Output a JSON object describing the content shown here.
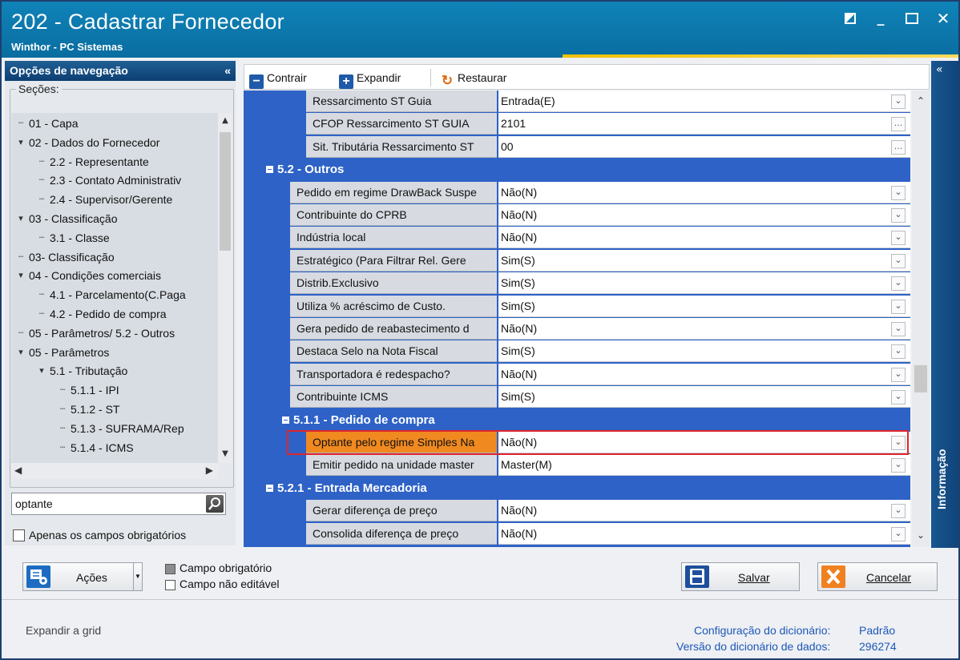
{
  "window": {
    "title": "202 - Cadastrar  Fornecedor",
    "subtitle": "Winthor - PC Sistemas"
  },
  "nav": {
    "header": "Opções de navegação",
    "collapse": "«",
    "sections_label": "Seções:",
    "tree": [
      {
        "label": "01 - Capa",
        "level": 0,
        "expander": ""
      },
      {
        "label": "02 - Dados do Fornecedor",
        "level": 0,
        "expander": "v"
      },
      {
        "label": "2.2 - Representante",
        "level": 1,
        "expander": ""
      },
      {
        "label": "2.3 - Contato Administrativ",
        "level": 1,
        "expander": ""
      },
      {
        "label": "2.4 - Supervisor/Gerente",
        "level": 1,
        "expander": ""
      },
      {
        "label": "03 - Classificação",
        "level": 0,
        "expander": "v"
      },
      {
        "label": "3.1 - Classe",
        "level": 1,
        "expander": ""
      },
      {
        "label": "03- Classificação",
        "level": 0,
        "expander": ""
      },
      {
        "label": "04 - Condições comerciais",
        "level": 0,
        "expander": "v"
      },
      {
        "label": "4.1 - Parcelamento(C.Paga",
        "level": 1,
        "expander": ""
      },
      {
        "label": "4.2 - Pedido de compra",
        "level": 1,
        "expander": ""
      },
      {
        "label": "05 - Parâmetros/ 5.2 - Outros",
        "level": 0,
        "expander": ""
      },
      {
        "label": "05 - Parâmetros",
        "level": 0,
        "expander": "v"
      },
      {
        "label": "5.1 - Tributação",
        "level": 1,
        "expander": "v"
      },
      {
        "label": "5.1.1 - IPI",
        "level": 2,
        "expander": ""
      },
      {
        "label": "5.1.2 - ST",
        "level": 2,
        "expander": ""
      },
      {
        "label": "5.1.3 - SUFRAMA/Rep",
        "level": 2,
        "expander": ""
      },
      {
        "label": "5.1.4 - ICMS",
        "level": 2,
        "expander": ""
      }
    ],
    "search_value": "optante",
    "only_required_label": "Apenas os campos obrigatórios"
  },
  "toolbar": {
    "collapse_label": "Contrair",
    "expand_label": "Expandir",
    "restore_label": "Restaurar"
  },
  "grid": {
    "rows": [
      {
        "type": "field",
        "name": "Ressarcimento ST Guia",
        "value": "Entrada(E)",
        "editor": "dropdown",
        "indent": 2
      },
      {
        "type": "field",
        "name": "CFOP Ressarcimento ST GUIA",
        "value": "2101",
        "editor": "ellipsis",
        "indent": 2
      },
      {
        "type": "field",
        "name": "Sit. Tributária Ressarcimento ST",
        "value": "00",
        "editor": "ellipsis",
        "indent": 2
      },
      {
        "type": "section",
        "name": "5.2 - Outros",
        "indent": 0
      },
      {
        "type": "field",
        "name": "Pedido em regime DrawBack Suspe",
        "value": "Não(N)",
        "editor": "dropdown",
        "indent": 1
      },
      {
        "type": "field",
        "name": "Contribuinte do CPRB",
        "value": "Não(N)",
        "editor": "dropdown",
        "indent": 1
      },
      {
        "type": "field",
        "name": "Indústria local",
        "value": "Não(N)",
        "editor": "dropdown",
        "indent": 1
      },
      {
        "type": "field",
        "name": "Estratégico  (Para Filtrar Rel. Gere",
        "value": "Sim(S)",
        "editor": "dropdown",
        "indent": 1
      },
      {
        "type": "field",
        "name": "Distrib.Exclusivo",
        "value": "Sim(S)",
        "editor": "dropdown",
        "indent": 1
      },
      {
        "type": "field",
        "name": "Utiliza % acréscimo de Custo.",
        "value": "Sim(S)",
        "editor": "dropdown",
        "indent": 1
      },
      {
        "type": "field",
        "name": "Gera pedido de reabastecimento d",
        "value": "Não(N)",
        "editor": "dropdown",
        "indent": 1
      },
      {
        "type": "field",
        "name": "Destaca Selo na Nota Fiscal",
        "value": "Sim(S)",
        "editor": "dropdown",
        "indent": 1
      },
      {
        "type": "field",
        "name": "Transportadora é redespacho?",
        "value": "Não(N)",
        "editor": "dropdown",
        "indent": 1
      },
      {
        "type": "field",
        "name": "Contribuinte ICMS",
        "value": "Sim(S)",
        "editor": "dropdown",
        "indent": 1
      },
      {
        "type": "section",
        "name": "5.1.1 - Pedido de compra",
        "indent": 1
      },
      {
        "type": "field",
        "name": "Optante pelo regime Simples Na",
        "value": "Não(N)",
        "editor": "dropdown",
        "indent": 2,
        "highlight": true
      },
      {
        "type": "field",
        "name": "Emitir pedido na unidade master",
        "value": "Master(M)",
        "editor": "dropdown",
        "indent": 2
      },
      {
        "type": "section",
        "name": "5.2.1 - Entrada Mercadoria",
        "indent": 0
      },
      {
        "type": "field",
        "name": "Gerar diferença de preço",
        "value": "Não(N)",
        "editor": "dropdown",
        "indent": 2
      },
      {
        "type": "field",
        "name": "Consolida diferença de preço",
        "value": "Não(N)",
        "editor": "dropdown",
        "indent": 2
      }
    ]
  },
  "info_panel": {
    "label": "Informação",
    "collapse": "«"
  },
  "footer": {
    "actions_label": "Ações",
    "legend_required": "Campo obrigatório",
    "legend_not_editable": "Campo não editável",
    "save_label": "Salvar",
    "cancel_label": "Cancelar",
    "status_text": "Expandir a grid",
    "dict_config_label": "Configuração do dicionário:",
    "dict_config_value": "Padrão",
    "dict_version_label": "Versão do dicionário de dados:",
    "dict_version_value": "296274"
  },
  "colors": {
    "titlebar": "#0a6da0",
    "grid_section": "#2e62c6",
    "highlight": "#f0891f",
    "link": "#1d57b8"
  }
}
